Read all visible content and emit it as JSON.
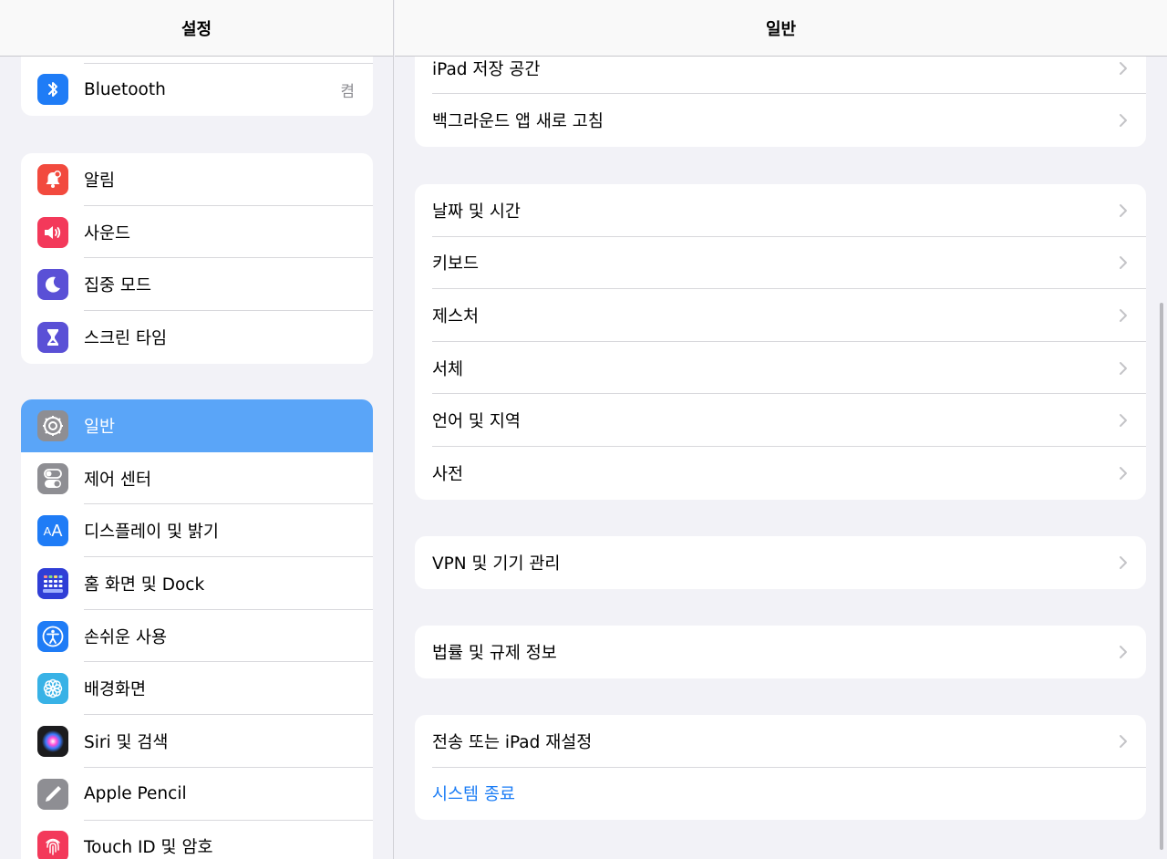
{
  "sidebar": {
    "title": "설정",
    "group0": [
      {
        "label": "Bluetooth",
        "value": "켬",
        "icon": "bluetooth-icon",
        "color": "#1f7cf6"
      }
    ],
    "group1": [
      {
        "label": "알림",
        "icon": "bell-icon",
        "color": "#f24a3e"
      },
      {
        "label": "사운드",
        "icon": "speaker-icon",
        "color": "#f3395a"
      },
      {
        "label": "집중 모드",
        "icon": "moon-icon",
        "color": "#5a50d6"
      },
      {
        "label": "스크린 타임",
        "icon": "hourglass-icon",
        "color": "#5a50d6"
      }
    ],
    "group2": [
      {
        "label": "일반",
        "icon": "gear-icon",
        "color": "#8e8e93",
        "selected": true
      },
      {
        "label": "제어 센터",
        "icon": "toggles-icon",
        "color": "#8e8e93"
      },
      {
        "label": "디스플레이 및 밝기",
        "icon": "text-size-icon",
        "color": "#1f7cf6"
      },
      {
        "label": "홈 화면 및 Dock",
        "icon": "home-grid-icon",
        "color": "#2f3ed6"
      },
      {
        "label": "손쉬운 사용",
        "icon": "accessibility-icon",
        "color": "#1f7cf6"
      },
      {
        "label": "배경화면",
        "icon": "flower-icon",
        "color": "#38b2e6"
      },
      {
        "label": "Siri 및 검색",
        "icon": "siri-icon",
        "color": "#222"
      },
      {
        "label": "Apple Pencil",
        "icon": "pencil-icon",
        "color": "#8e8e93"
      },
      {
        "label": "Touch ID 및 암호",
        "icon": "fingerprint-icon",
        "color": "#f3395a"
      }
    ]
  },
  "detail": {
    "title": "일반",
    "groups": [
      [
        "iPad 저장 공간",
        "백그라운드 앱 새로 고침"
      ],
      [
        "날짜 및 시간",
        "키보드",
        "제스처",
        "서체",
        "언어 및 지역",
        "사전"
      ],
      [
        "VPN 및 기기 관리"
      ],
      [
        "법률 및 규제 정보"
      ],
      [
        "전송 또는 iPad 재설정"
      ]
    ],
    "shutdown": "시스템 종료"
  }
}
